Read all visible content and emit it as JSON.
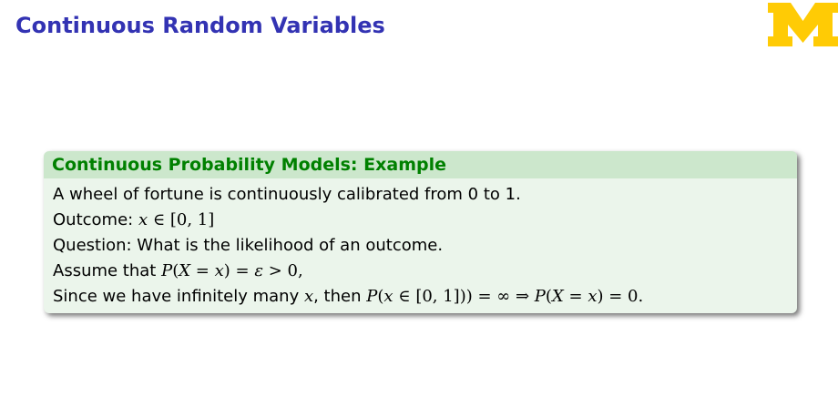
{
  "slide": {
    "title": "Continuous Random Variables"
  },
  "logo": {
    "name": "university-of-michigan-block-m",
    "color": "#ffcb05"
  },
  "block": {
    "title": "Continuous Probability Models: Example",
    "lines": [
      {
        "text": "A wheel of fortune is continuously calibrated from 0 to 1."
      },
      {
        "prefix": "Outcome: ",
        "var_x": "x",
        "relation": " ∈ [0, 1]"
      },
      {
        "text": "Question: What is the likelihood of an outcome."
      },
      {
        "prefix": "Assume that ",
        "p": "P",
        "open": "(",
        "var_X": "X",
        "eq": " = ",
        "var_x": "x",
        "close": ")",
        "eq2": " = ",
        "eps": "ε",
        "gt": " > 0,"
      },
      {
        "prefix": "Since we have infinitely many ",
        "var_x": "x",
        "mid": ", then ",
        "p1": "P",
        "open1": "(",
        "var_x2": "x",
        "in": " ∈ [0, 1])) = ∞ ⇒ ",
        "p2": "P",
        "open2": "(",
        "var_X": "X",
        "eq": " = ",
        "var_x3": "x",
        "close2": ")",
        "end": " = 0."
      }
    ]
  },
  "colors": {
    "title": "#3333b3",
    "block_header_bg": "#cce7cc",
    "block_header_text": "#008000",
    "block_body_bg": "#ebf5eb"
  }
}
